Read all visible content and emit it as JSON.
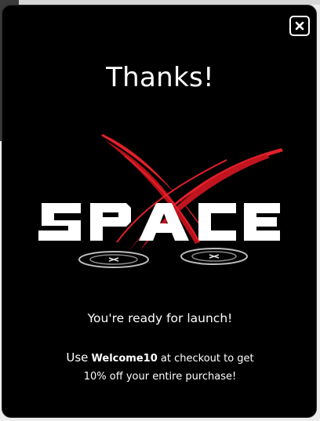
{
  "modal": {
    "title": "Thanks!",
    "close_label": "×",
    "logo": {
      "text": "SPACE",
      "letters": [
        "S",
        "P",
        "A",
        "C",
        "E"
      ],
      "accent_color": "#e1202a"
    },
    "tagline": "You're ready for launch!",
    "promo": {
      "prefix": "Use",
      "code": "Welcome10",
      "line1_suffix": "at checkout to get",
      "line2": "10% off your entire purchase!"
    }
  },
  "colors": {
    "modal_background": "#000000",
    "text": "#ffffff",
    "accent": "#e1202a"
  }
}
